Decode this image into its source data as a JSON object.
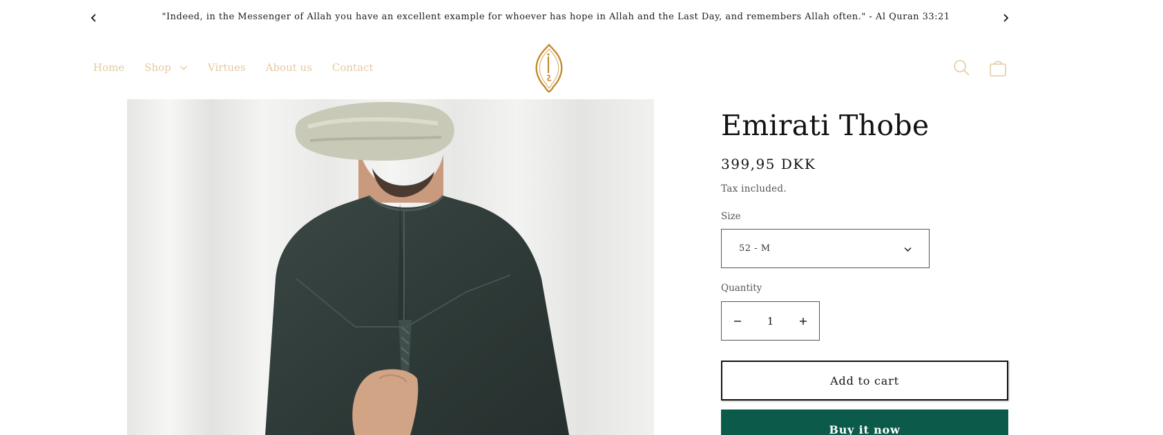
{
  "announcement": {
    "text": "\"Indeed, in the Messenger of Allah you have an excellent example for whoever has hope in Allah and the Last Day, and remembers Allah often.\" - Al Quran 33:21"
  },
  "nav": {
    "home": "Home",
    "shop": "Shop",
    "virtues": "Virtues",
    "about": "About us",
    "contact": "Contact"
  },
  "product": {
    "title": "Emirati Thobe",
    "price": "399,95 DKK",
    "tax_note": "Tax included.",
    "size_label": "Size",
    "size_value": "52 - M",
    "quantity_label": "Quantity",
    "quantity_value": "1",
    "add_to_cart": "Add to cart",
    "buy_now": "Buy it now"
  },
  "colors": {
    "nav_text": "#e3c9a2",
    "accent_gold": "#c08a2e",
    "buy_button": "#0b5a4a"
  },
  "icons": [
    "chevron-left-icon",
    "chevron-right-icon",
    "chevron-down-icon",
    "search-icon",
    "shopping-bag-icon",
    "minus-icon",
    "plus-icon"
  ]
}
